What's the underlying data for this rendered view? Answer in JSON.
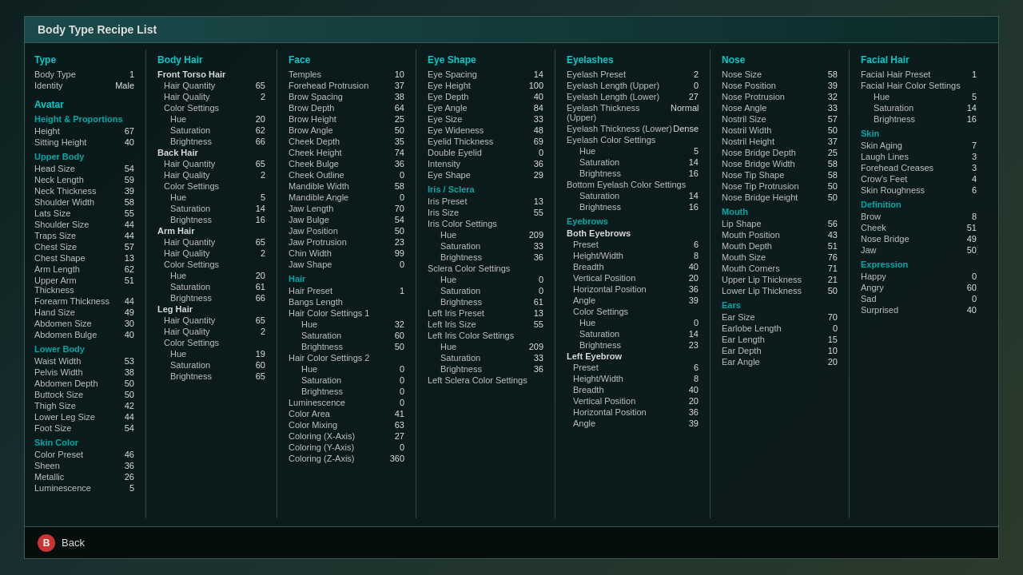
{
  "title": "Body Type Recipe List",
  "type_section": {
    "header": "Type",
    "body_type_label": "Body Type",
    "body_type_value": "1",
    "identity_label": "Identity",
    "identity_value": "Male"
  },
  "avatar_section": {
    "header": "Avatar"
  },
  "height_proportions": {
    "header": "Height & Proportions",
    "items": [
      {
        "label": "Height",
        "value": "67"
      },
      {
        "label": "Sitting Height",
        "value": "40"
      }
    ]
  },
  "upper_body": {
    "header": "Upper Body",
    "items": [
      {
        "label": "Head Size",
        "value": "54"
      },
      {
        "label": "Neck Length",
        "value": "59"
      },
      {
        "label": "Neck Thickness",
        "value": "39"
      },
      {
        "label": "Shoulder Width",
        "value": "58"
      },
      {
        "label": "Lats Size",
        "value": "55"
      },
      {
        "label": "Shoulder Size",
        "value": "44"
      },
      {
        "label": "Traps Size",
        "value": "44"
      },
      {
        "label": "Chest Size",
        "value": "57"
      },
      {
        "label": "Chest Shape",
        "value": "13"
      },
      {
        "label": "Arm Length",
        "value": "62"
      },
      {
        "label": "Upper Arm Thickness",
        "value": "51"
      },
      {
        "label": "Forearm Thickness",
        "value": "44"
      },
      {
        "label": "Hand Size",
        "value": "49"
      },
      {
        "label": "Abdomen Size",
        "value": "30"
      },
      {
        "label": "Abdomen Bulge",
        "value": "40"
      }
    ]
  },
  "lower_body": {
    "header": "Lower Body",
    "items": [
      {
        "label": "Waist Width",
        "value": "53"
      },
      {
        "label": "Pelvis Width",
        "value": "38"
      },
      {
        "label": "Abdomen Depth",
        "value": "50"
      },
      {
        "label": "Buttock Size",
        "value": "50"
      },
      {
        "label": "Thigh Size",
        "value": "42"
      },
      {
        "label": "Lower Leg Size",
        "value": "44"
      },
      {
        "label": "Foot Size",
        "value": "54"
      }
    ]
  },
  "skin_color": {
    "header": "Skin Color",
    "items": [
      {
        "label": "Color Preset",
        "value": "46"
      },
      {
        "label": "Sheen",
        "value": "36"
      },
      {
        "label": "Metallic",
        "value": "26"
      },
      {
        "label": "Luminescence",
        "value": "5"
      }
    ]
  },
  "body_hair": {
    "header": "Body Hair",
    "front_torso": {
      "label": "Front Torso Hair",
      "items": [
        {
          "label": "Hair Quantity",
          "value": "65"
        },
        {
          "label": "Hair Quality",
          "value": "2"
        },
        {
          "label": "Color Settings",
          "value": ""
        },
        {
          "label": "Hue",
          "value": "20",
          "indent": true
        },
        {
          "label": "Saturation",
          "value": "62",
          "indent": true
        },
        {
          "label": "Brightness",
          "value": "66",
          "indent": true
        }
      ]
    },
    "back_hair": {
      "label": "Back Hair",
      "items": [
        {
          "label": "Hair Quantity",
          "value": "65"
        },
        {
          "label": "Hair Quality",
          "value": "2"
        },
        {
          "label": "Color Settings",
          "value": ""
        },
        {
          "label": "Hue",
          "value": "5",
          "indent": true
        },
        {
          "label": "Saturation",
          "value": "14",
          "indent": true
        },
        {
          "label": "Brightness",
          "value": "16",
          "indent": true
        }
      ]
    },
    "arm_hair": {
      "label": "Arm Hair",
      "items": [
        {
          "label": "Hair Quantity",
          "value": "65"
        },
        {
          "label": "Hair Quality",
          "value": "2"
        },
        {
          "label": "Color Settings",
          "value": ""
        },
        {
          "label": "Hue",
          "value": "20",
          "indent": true
        },
        {
          "label": "Saturation",
          "value": "61",
          "indent": true
        },
        {
          "label": "Brightness",
          "value": "66",
          "indent": true
        }
      ]
    },
    "leg_hair": {
      "label": "Leg Hair",
      "items": [
        {
          "label": "Hair Quantity",
          "value": "65"
        },
        {
          "label": "Hair Quality",
          "value": "2"
        },
        {
          "label": "Color Settings",
          "value": ""
        },
        {
          "label": "Hue",
          "value": "19",
          "indent": true
        },
        {
          "label": "Saturation",
          "value": "60",
          "indent": true
        },
        {
          "label": "Brightness",
          "value": "65",
          "indent": true
        }
      ]
    }
  },
  "face": {
    "header": "Face",
    "items": [
      {
        "label": "Temples",
        "value": "10"
      },
      {
        "label": "Forehead Protrusion",
        "value": "37"
      },
      {
        "label": "Brow Spacing",
        "value": "38"
      },
      {
        "label": "Brow Depth",
        "value": "64"
      },
      {
        "label": "Brow Height",
        "value": "25"
      },
      {
        "label": "Brow Angle",
        "value": "50"
      },
      {
        "label": "Cheek Depth",
        "value": "35"
      },
      {
        "label": "Cheek Height",
        "value": "74"
      },
      {
        "label": "Cheek Bulge",
        "value": "36"
      },
      {
        "label": "Cheek Outline",
        "value": "0"
      },
      {
        "label": "Mandible Width",
        "value": "58"
      },
      {
        "label": "Mandible Angle",
        "value": "0"
      },
      {
        "label": "Jaw Length",
        "value": "70"
      },
      {
        "label": "Jaw Bulge",
        "value": "54"
      },
      {
        "label": "Jaw Position",
        "value": "50"
      },
      {
        "label": "Jaw Protrusion",
        "value": "23"
      },
      {
        "label": "Chin Width",
        "value": "99"
      },
      {
        "label": "Jaw Shape",
        "value": "0"
      }
    ]
  },
  "hair": {
    "header": "Hair",
    "items": [
      {
        "label": "Hair Preset",
        "value": "1"
      },
      {
        "label": "Bangs Length",
        "value": ""
      },
      {
        "label": "Hair Color Settings 1",
        "value": ""
      },
      {
        "label": "Hue",
        "value": "32",
        "indent": true
      },
      {
        "label": "Saturation",
        "value": "60",
        "indent": true
      },
      {
        "label": "Brightness",
        "value": "50",
        "indent": true
      },
      {
        "label": "Hair Color Settings 2",
        "value": ""
      },
      {
        "label": "Hue",
        "value": "0",
        "indent": true
      },
      {
        "label": "Saturation",
        "value": "0",
        "indent": true
      },
      {
        "label": "Brightness",
        "value": "0",
        "indent": true
      },
      {
        "label": "Luminescence",
        "value": "0"
      },
      {
        "label": "Color Area",
        "value": "41"
      },
      {
        "label": "Color Mixing",
        "value": "63"
      },
      {
        "label": "Coloring (X-Axis)",
        "value": "27"
      },
      {
        "label": "Coloring (Y-Axis)",
        "value": "0"
      },
      {
        "label": "Coloring (Z-Axis)",
        "value": "360"
      }
    ]
  },
  "eye_shape": {
    "header": "Eye Shape",
    "items": [
      {
        "label": "Eye Spacing",
        "value": "14"
      },
      {
        "label": "Eye Height",
        "value": "100"
      },
      {
        "label": "Eye Depth",
        "value": "40"
      },
      {
        "label": "Eye Angle",
        "value": "84"
      },
      {
        "label": "Eye Size",
        "value": "33"
      },
      {
        "label": "Eye Wideness",
        "value": "48"
      },
      {
        "label": "Eyelid Thickness",
        "value": "69"
      },
      {
        "label": "Double Eyelid",
        "value": "0"
      },
      {
        "label": "Intensity",
        "value": "36"
      },
      {
        "label": "Eye Shape",
        "value": "29"
      }
    ]
  },
  "iris_sclera": {
    "header": "Iris / Sclera",
    "items": [
      {
        "label": "Iris Preset",
        "value": "13"
      },
      {
        "label": "Iris Size",
        "value": "55"
      },
      {
        "label": "Iris Color Settings",
        "value": ""
      },
      {
        "label": "Hue",
        "value": "209",
        "indent": true
      },
      {
        "label": "Saturation",
        "value": "33",
        "indent": true
      },
      {
        "label": "Brightness",
        "value": "36",
        "indent": true
      },
      {
        "label": "Sclera Color Settings",
        "value": ""
      },
      {
        "label": "Hue",
        "value": "0",
        "indent": true
      },
      {
        "label": "Saturation",
        "value": "0",
        "indent": true
      },
      {
        "label": "Brightness",
        "value": "61",
        "indent": true
      },
      {
        "label": "Left Iris Preset",
        "value": "13"
      },
      {
        "label": "Left Iris Size",
        "value": "55"
      },
      {
        "label": "Left Iris Color Settings",
        "value": ""
      },
      {
        "label": "Hue",
        "value": "209",
        "indent": true
      },
      {
        "label": "Saturation",
        "value": "33",
        "indent": true
      },
      {
        "label": "Brightness",
        "value": "36",
        "indent": true
      },
      {
        "label": "Left Sclera Color Settings",
        "value": ""
      }
    ]
  },
  "eyelashes": {
    "header": "Eyelashes",
    "items": [
      {
        "label": "Eyelash Preset",
        "value": "2"
      },
      {
        "label": "Eyelash Length (Upper)",
        "value": "0"
      },
      {
        "label": "Eyelash Length (Lower)",
        "value": "27"
      },
      {
        "label": "Eyelash Thickness (Upper)",
        "value": "Normal"
      },
      {
        "label": "Eyelash Thickness (Lower)",
        "value": "Dense"
      },
      {
        "label": "Eyelash Color Settings",
        "value": ""
      },
      {
        "label": "Hue",
        "value": "5",
        "indent": true
      },
      {
        "label": "Saturation",
        "value": "14",
        "indent": true
      },
      {
        "label": "Brightness",
        "value": "16",
        "indent": true
      },
      {
        "label": "Bottom Eyelash Color Settings",
        "value": ""
      },
      {
        "label": "Saturation",
        "value": "14",
        "indent": true
      },
      {
        "label": "Brightness",
        "value": "16",
        "indent": true
      }
    ]
  },
  "eyebrows": {
    "header": "Eyebrows",
    "both": {
      "label": "Both Eyebrows",
      "items": [
        {
          "label": "Preset",
          "value": "6"
        },
        {
          "label": "Height/Width",
          "value": "8"
        },
        {
          "label": "Breadth",
          "value": "40"
        },
        {
          "label": "Vertical Position",
          "value": "20"
        },
        {
          "label": "Horizontal Position",
          "value": "36"
        },
        {
          "label": "Angle",
          "value": "39"
        },
        {
          "label": "Color Settings",
          "value": ""
        },
        {
          "label": "Hue",
          "value": "0",
          "indent": true
        },
        {
          "label": "Saturation",
          "value": "14",
          "indent": true
        },
        {
          "label": "Brightness",
          "value": "23",
          "indent": true
        }
      ]
    },
    "left": {
      "label": "Left Eyebrow",
      "items": [
        {
          "label": "Preset",
          "value": "6"
        },
        {
          "label": "Height/Width",
          "value": "8"
        },
        {
          "label": "Breadth",
          "value": "40"
        },
        {
          "label": "Vertical Position",
          "value": "20"
        },
        {
          "label": "Horizontal Position",
          "value": "36"
        },
        {
          "label": "Angle",
          "value": "39"
        }
      ]
    }
  },
  "nose": {
    "header": "Nose",
    "items": [
      {
        "label": "Nose Size",
        "value": "58"
      },
      {
        "label": "Nose Position",
        "value": "39"
      },
      {
        "label": "Nose Protrusion",
        "value": "32"
      },
      {
        "label": "Nose Angle",
        "value": "33"
      },
      {
        "label": "Nostril Size",
        "value": "57"
      },
      {
        "label": "Nostril Width",
        "value": "50"
      },
      {
        "label": "Nostril Height",
        "value": "37"
      },
      {
        "label": "Nose Bridge Depth",
        "value": "25"
      },
      {
        "label": "Nose Bridge Width",
        "value": "58"
      },
      {
        "label": "Nose Tip Shape",
        "value": "58"
      },
      {
        "label": "Nose Tip Protrusion",
        "value": "50"
      },
      {
        "label": "Nose Bridge Height",
        "value": "50"
      }
    ]
  },
  "mouth": {
    "header": "Mouth",
    "items": [
      {
        "label": "Lip Shape",
        "value": "56"
      },
      {
        "label": "Mouth Position",
        "value": "43"
      },
      {
        "label": "Mouth Depth",
        "value": "51"
      },
      {
        "label": "Mouth Size",
        "value": "76"
      },
      {
        "label": "Mouth Corners",
        "value": "71"
      },
      {
        "label": "Upper Lip Thickness",
        "value": "21"
      },
      {
        "label": "Lower Lip Thickness",
        "value": "50"
      }
    ]
  },
  "ears": {
    "header": "Ears",
    "items": [
      {
        "label": "Ear Size",
        "value": "70"
      },
      {
        "label": "Earlobe Length",
        "value": "0"
      },
      {
        "label": "Ear Length",
        "value": "15"
      },
      {
        "label": "Ear Depth",
        "value": "10"
      },
      {
        "label": "Ear Angle",
        "value": "20"
      }
    ]
  },
  "facial_hair": {
    "header": "Facial Hair",
    "items": [
      {
        "label": "Facial Hair Preset",
        "value": "1"
      },
      {
        "label": "Facial Hair Color Settings",
        "value": ""
      },
      {
        "label": "Hue",
        "value": "5",
        "indent": true
      },
      {
        "label": "Saturation",
        "value": "14",
        "indent": true
      },
      {
        "label": "Brightness",
        "value": "16",
        "indent": true
      }
    ]
  },
  "skin": {
    "header": "Skin",
    "items": [
      {
        "label": "Skin Aging",
        "value": "7"
      },
      {
        "label": "Laugh Lines",
        "value": "3"
      },
      {
        "label": "Forehead Creases",
        "value": "3"
      },
      {
        "label": "Crow's Feet",
        "value": "4"
      },
      {
        "label": "Skin Roughness",
        "value": "6"
      }
    ]
  },
  "definition": {
    "header": "Definition",
    "items": [
      {
        "label": "Brow",
        "value": "8"
      },
      {
        "label": "Cheek",
        "value": "51"
      },
      {
        "label": "Nose Bridge",
        "value": "49"
      },
      {
        "label": "Jaw",
        "value": "50"
      }
    ]
  },
  "expression": {
    "header": "Expression",
    "items": [
      {
        "label": "Happy",
        "value": "0"
      },
      {
        "label": "Angry",
        "value": "60"
      },
      {
        "label": "Sad",
        "value": "0"
      },
      {
        "label": "Surprised",
        "value": "40"
      }
    ]
  },
  "back_button": {
    "icon": "B",
    "label": "Back"
  }
}
